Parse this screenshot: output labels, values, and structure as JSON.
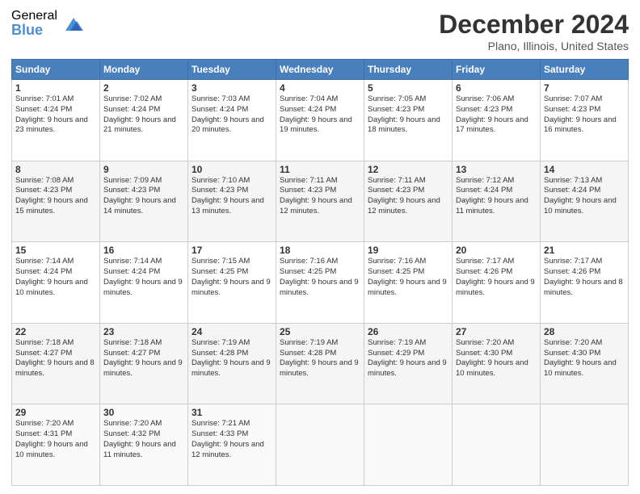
{
  "logo": {
    "general": "General",
    "blue": "Blue"
  },
  "header": {
    "title": "December 2024",
    "location": "Plano, Illinois, United States"
  },
  "days_of_week": [
    "Sunday",
    "Monday",
    "Tuesday",
    "Wednesday",
    "Thursday",
    "Friday",
    "Saturday"
  ],
  "weeks": [
    [
      {
        "day": "1",
        "sunrise": "7:01 AM",
        "sunset": "4:24 PM",
        "daylight": "9 hours and 23 minutes."
      },
      {
        "day": "2",
        "sunrise": "7:02 AM",
        "sunset": "4:24 PM",
        "daylight": "9 hours and 21 minutes."
      },
      {
        "day": "3",
        "sunrise": "7:03 AM",
        "sunset": "4:24 PM",
        "daylight": "9 hours and 20 minutes."
      },
      {
        "day": "4",
        "sunrise": "7:04 AM",
        "sunset": "4:24 PM",
        "daylight": "9 hours and 19 minutes."
      },
      {
        "day": "5",
        "sunrise": "7:05 AM",
        "sunset": "4:23 PM",
        "daylight": "9 hours and 18 minutes."
      },
      {
        "day": "6",
        "sunrise": "7:06 AM",
        "sunset": "4:23 PM",
        "daylight": "9 hours and 17 minutes."
      },
      {
        "day": "7",
        "sunrise": "7:07 AM",
        "sunset": "4:23 PM",
        "daylight": "9 hours and 16 minutes."
      }
    ],
    [
      {
        "day": "8",
        "sunrise": "7:08 AM",
        "sunset": "4:23 PM",
        "daylight": "9 hours and 15 minutes."
      },
      {
        "day": "9",
        "sunrise": "7:09 AM",
        "sunset": "4:23 PM",
        "daylight": "9 hours and 14 minutes."
      },
      {
        "day": "10",
        "sunrise": "7:10 AM",
        "sunset": "4:23 PM",
        "daylight": "9 hours and 13 minutes."
      },
      {
        "day": "11",
        "sunrise": "7:11 AM",
        "sunset": "4:23 PM",
        "daylight": "9 hours and 12 minutes."
      },
      {
        "day": "12",
        "sunrise": "7:11 AM",
        "sunset": "4:23 PM",
        "daylight": "9 hours and 12 minutes."
      },
      {
        "day": "13",
        "sunrise": "7:12 AM",
        "sunset": "4:24 PM",
        "daylight": "9 hours and 11 minutes."
      },
      {
        "day": "14",
        "sunrise": "7:13 AM",
        "sunset": "4:24 PM",
        "daylight": "9 hours and 10 minutes."
      }
    ],
    [
      {
        "day": "15",
        "sunrise": "7:14 AM",
        "sunset": "4:24 PM",
        "daylight": "9 hours and 10 minutes."
      },
      {
        "day": "16",
        "sunrise": "7:14 AM",
        "sunset": "4:24 PM",
        "daylight": "9 hours and 9 minutes."
      },
      {
        "day": "17",
        "sunrise": "7:15 AM",
        "sunset": "4:25 PM",
        "daylight": "9 hours and 9 minutes."
      },
      {
        "day": "18",
        "sunrise": "7:16 AM",
        "sunset": "4:25 PM",
        "daylight": "9 hours and 9 minutes."
      },
      {
        "day": "19",
        "sunrise": "7:16 AM",
        "sunset": "4:25 PM",
        "daylight": "9 hours and 9 minutes."
      },
      {
        "day": "20",
        "sunrise": "7:17 AM",
        "sunset": "4:26 PM",
        "daylight": "9 hours and 9 minutes."
      },
      {
        "day": "21",
        "sunrise": "7:17 AM",
        "sunset": "4:26 PM",
        "daylight": "9 hours and 8 minutes."
      }
    ],
    [
      {
        "day": "22",
        "sunrise": "7:18 AM",
        "sunset": "4:27 PM",
        "daylight": "9 hours and 8 minutes."
      },
      {
        "day": "23",
        "sunrise": "7:18 AM",
        "sunset": "4:27 PM",
        "daylight": "9 hours and 9 minutes."
      },
      {
        "day": "24",
        "sunrise": "7:19 AM",
        "sunset": "4:28 PM",
        "daylight": "9 hours and 9 minutes."
      },
      {
        "day": "25",
        "sunrise": "7:19 AM",
        "sunset": "4:28 PM",
        "daylight": "9 hours and 9 minutes."
      },
      {
        "day": "26",
        "sunrise": "7:19 AM",
        "sunset": "4:29 PM",
        "daylight": "9 hours and 9 minutes."
      },
      {
        "day": "27",
        "sunrise": "7:20 AM",
        "sunset": "4:30 PM",
        "daylight": "9 hours and 10 minutes."
      },
      {
        "day": "28",
        "sunrise": "7:20 AM",
        "sunset": "4:30 PM",
        "daylight": "9 hours and 10 minutes."
      }
    ],
    [
      {
        "day": "29",
        "sunrise": "7:20 AM",
        "sunset": "4:31 PM",
        "daylight": "9 hours and 10 minutes."
      },
      {
        "day": "30",
        "sunrise": "7:20 AM",
        "sunset": "4:32 PM",
        "daylight": "9 hours and 11 minutes."
      },
      {
        "day": "31",
        "sunrise": "7:21 AM",
        "sunset": "4:33 PM",
        "daylight": "9 hours and 12 minutes."
      },
      null,
      null,
      null,
      null
    ]
  ]
}
